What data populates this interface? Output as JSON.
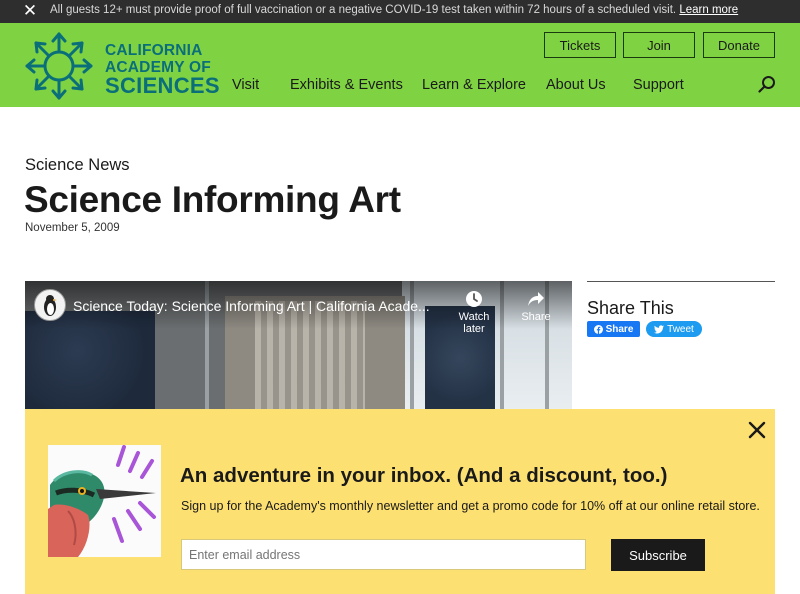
{
  "alert": {
    "message": "All guests 12+ must provide proof of full vaccination or a negative COVID-19 test taken within 72 hours of a scheduled visit.",
    "link": "Learn more"
  },
  "brand": {
    "line1": "CALIFORNIA",
    "line2": "ACADEMY OF",
    "line3": "SCIENCES",
    "color": "#0b6f7a",
    "header_bg": "#7fd343"
  },
  "utility_nav": [
    "Tickets",
    "Join",
    "Donate"
  ],
  "main_nav": [
    "Visit",
    "Exhibits & Events",
    "Learn & Explore",
    "About Us",
    "Support"
  ],
  "article": {
    "section": "Science News",
    "title": "Science Informing Art",
    "date": "November 5, 2009"
  },
  "video": {
    "title": "Science Today: Science Informing Art | California Acade...",
    "watch_later": "Watch later",
    "share": "Share"
  },
  "share": {
    "heading": "Share This",
    "facebook": "Share",
    "twitter": "Tweet"
  },
  "newsletter": {
    "headline": "An adventure in your inbox. (And a discount, too.)",
    "subtext": "Sign up for the Academy's monthly newsletter and get a promo code for 10% off at our online retail store.",
    "placeholder": "Enter email address",
    "button": "Subscribe",
    "bg_color": "#fde072"
  }
}
